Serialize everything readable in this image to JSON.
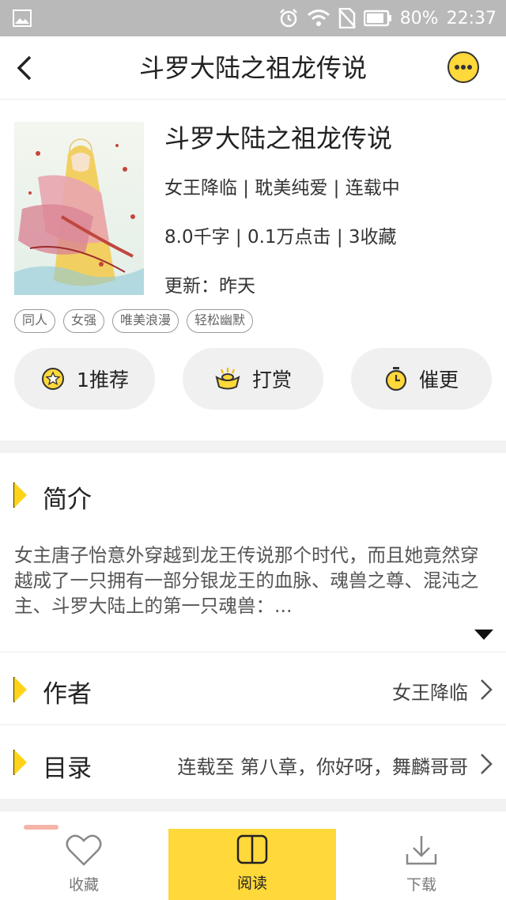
{
  "status": {
    "battery": "80%",
    "time": "22:37"
  },
  "nav": {
    "title": "斗罗大陆之祖龙传说"
  },
  "book": {
    "title": "斗罗大陆之祖龙传说",
    "meta1": "女王降临 | 耽美纯爱 | 连载中",
    "meta2": "8.0千字 | 0.1万点击 | 3收藏",
    "update": "更新：昨天",
    "tags": [
      "同人",
      "女强",
      "唯美浪漫",
      "轻松幽默"
    ]
  },
  "actions": {
    "recommend": "1推荐",
    "reward": "打赏",
    "urge": "催更"
  },
  "intro": {
    "title": "简介",
    "text": "女主唐子怡意外穿越到龙王传说那个时代，而且她竟然穿越成了一只拥有一部分银龙王的血脉、魂兽之尊、混沌之主、斗罗大陆上的第一只魂兽：..."
  },
  "author": {
    "label": "作者",
    "value": "女王降临"
  },
  "catalog": {
    "label": "目录",
    "value": "连载至 第八章，你好呀，舞麟哥哥"
  },
  "tabbar": {
    "collect": "收藏",
    "read": "阅读",
    "download": "下载"
  },
  "colors": {
    "accent": "#ffd83a",
    "page_bg": "#ffffff",
    "gap": "#f2f2f2"
  }
}
